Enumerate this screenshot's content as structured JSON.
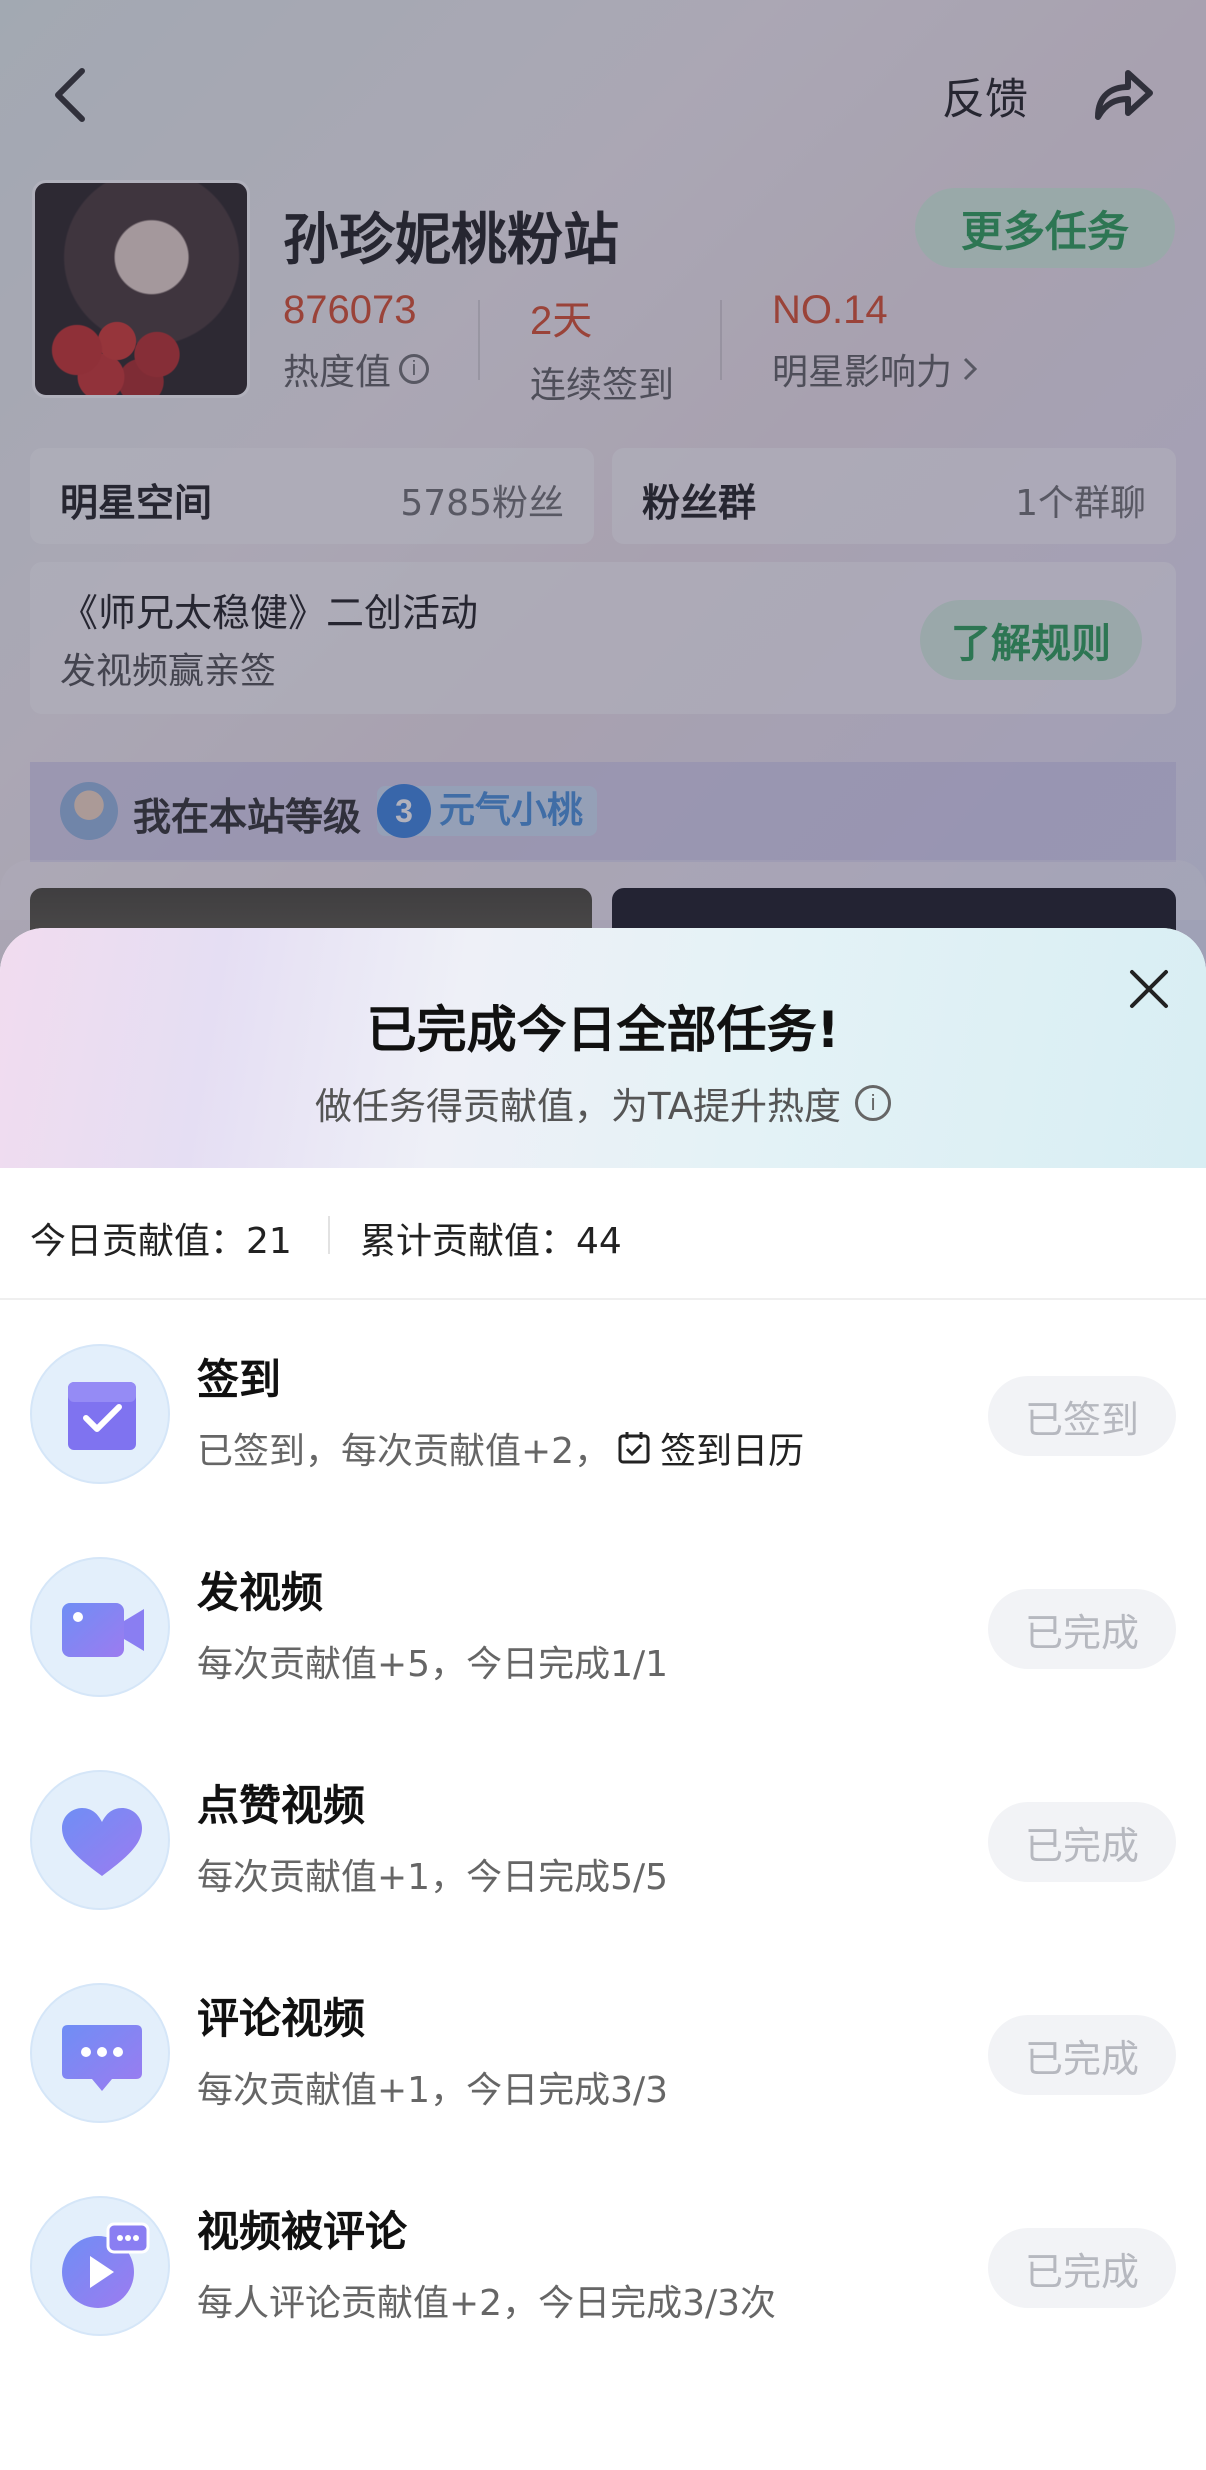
{
  "header": {
    "feedback_label": "反馈"
  },
  "fan_site": {
    "title": "孙珍妮桃粉站",
    "more_tasks_label": "更多任务",
    "stats": [
      {
        "value": "876073",
        "label": "热度值"
      },
      {
        "value": "2天",
        "label": "连续签到"
      },
      {
        "value": "NO.14",
        "label": "明星影响力"
      }
    ],
    "star_space": {
      "label": "明星空间",
      "count": "5785粉丝"
    },
    "fan_group": {
      "label": "粉丝群",
      "count": "1个群聊"
    },
    "activity": {
      "title": "《师兄太稳健》二创活动",
      "subtitle": "发视频赢亲签",
      "button_label": "了解规则"
    },
    "level": {
      "label": "我在本站等级",
      "number": "3",
      "name": "元气小桃"
    }
  },
  "sheet": {
    "title": "已完成今日全部任务!",
    "subtitle": "做任务得贡献值，为TA提升热度",
    "today_contribution": "今日贡献值：21",
    "total_contribution": "累计贡献值：44",
    "tasks": [
      {
        "name": "签到",
        "desc": "已签到，每次贡献值+2，",
        "extra": "签到日历",
        "button": "已签到",
        "icon": "checkbox-icon"
      },
      {
        "name": "发视频",
        "desc": "每次贡献值+5，今日完成1/1",
        "button": "已完成",
        "icon": "video-camera-icon"
      },
      {
        "name": "点赞视频",
        "desc": "每次贡献值+1，今日完成5/5",
        "button": "已完成",
        "icon": "heart-icon"
      },
      {
        "name": "评论视频",
        "desc": "每次贡献值+1，今日完成3/3",
        "button": "已完成",
        "icon": "comment-icon"
      },
      {
        "name": "视频被评论",
        "desc": "每人评论贡献值+2，今日完成3/3次",
        "button": "已完成",
        "icon": "video-comment-icon"
      }
    ]
  },
  "colors": {
    "accent_red": "#d8421e",
    "accent_green": "#1d9a4b",
    "icon_purple": "#7f73f0"
  }
}
